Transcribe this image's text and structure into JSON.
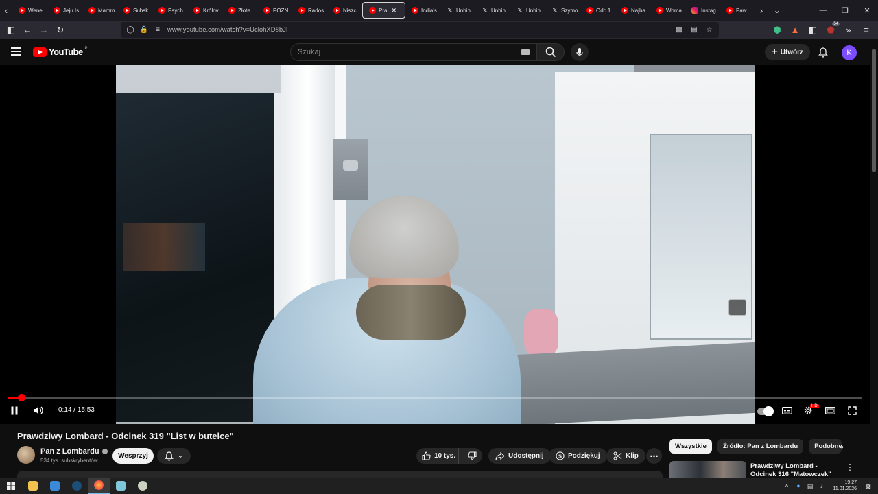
{
  "browser": {
    "tabs": [
      {
        "label": "Wene",
        "icon": "youtube-favicon"
      },
      {
        "label": "Jeju Is",
        "icon": "youtube-favicon"
      },
      {
        "label": "Mamm",
        "icon": "youtube-favicon"
      },
      {
        "label": "Subsk",
        "icon": "youtube-favicon"
      },
      {
        "label": "Psych",
        "icon": "youtube-favicon"
      },
      {
        "label": "Królov",
        "icon": "youtube-favicon"
      },
      {
        "label": "Złote",
        "icon": "youtube-favicon"
      },
      {
        "label": "POZN",
        "icon": "youtube-favicon"
      },
      {
        "label": "Rados",
        "icon": "youtube-favicon"
      },
      {
        "label": "Niszc",
        "icon": "youtube-favicon"
      },
      {
        "label": "Pra",
        "icon": "youtube-favicon",
        "active": true
      },
      {
        "label": "India's",
        "icon": "youtube-favicon"
      },
      {
        "label": "Unhin",
        "icon": "x-favicon"
      },
      {
        "label": "Unhin",
        "icon": "x-favicon"
      },
      {
        "label": "Unhin",
        "icon": "x-favicon"
      },
      {
        "label": "Szymo",
        "icon": "x-favicon"
      },
      {
        "label": "Odc.1",
        "icon": "youtube-favicon"
      },
      {
        "label": "Najba",
        "icon": "youtube-favicon"
      },
      {
        "label": "Woma",
        "icon": "youtube-favicon"
      },
      {
        "label": "Instag",
        "icon": "instagram-favicon"
      },
      {
        "label": "Paw",
        "icon": "youtube-favicon"
      }
    ],
    "url": "www.youtube.com/watch?v=UclohXD8bJI",
    "extensions_badge": "54"
  },
  "youtube": {
    "logo_text": "YouTube",
    "logo_country": "PL",
    "search_placeholder": "Szukaj",
    "create_label": "Utwórz",
    "avatar_letter": "K",
    "accent": "#ff0000"
  },
  "player": {
    "time_current": "0:14",
    "time_total": "15:53",
    "time_separator": "/",
    "progress_fraction": 0.015,
    "autoplay_on": true,
    "quality_badge": "HD"
  },
  "video": {
    "title": "Prawdziwy Lombard - Odcinek 319 \"List w butelce\"",
    "channel_name": "Pan z Lombardu",
    "subscribers": "534 tys. subskrybentów",
    "support_label": "Wesprzyj",
    "likes": "10 tys.",
    "share_label": "Udostępnij",
    "thanks_label": "Podziękuj",
    "clip_label": "Klip"
  },
  "sidebar": {
    "chips": [
      "Wszystkie",
      "Źródło: Pan z Lombardu",
      "Podobne"
    ],
    "active_chip": 0,
    "recommended": [
      {
        "title": "Prawdziwy Lombard - Odcinek 316 \"Matowczek\""
      }
    ]
  },
  "taskbar": {
    "time": "19:27",
    "date": "11.01.2026"
  }
}
